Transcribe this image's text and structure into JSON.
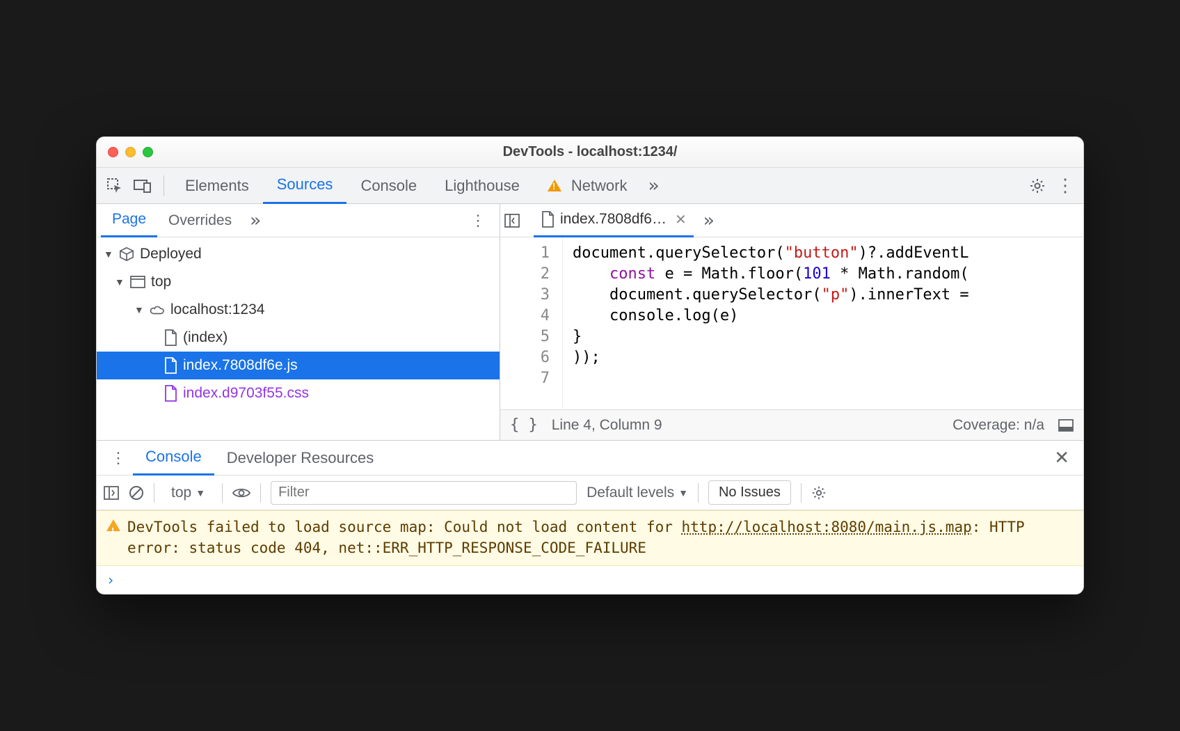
{
  "window": {
    "title": "DevTools - localhost:1234/"
  },
  "panels": {
    "elements": "Elements",
    "sources": "Sources",
    "console": "Console",
    "lighthouse": "Lighthouse",
    "network": "Network"
  },
  "sources": {
    "subtabs": {
      "page": "Page",
      "overrides": "Overrides"
    },
    "tree": {
      "deployed": "Deployed",
      "top": "top",
      "host": "localhost:1234",
      "index": "(index)",
      "js": "index.7808df6e.js",
      "css": "index.d9703f55.css"
    },
    "open_tab": "index.7808df6…",
    "code": {
      "l1": "document.querySelector(\"button\")?.addEventL",
      "l2_pre": "    ",
      "l2_kw": "const",
      "l2_mid": " e = Math.floor(",
      "l2_num": "101",
      "l2_rest": " * Math.random(",
      "l3": "    document.querySelector(\"p\").innerText =",
      "l4": "    console.log(e)",
      "l5": "}",
      "l6": "));",
      "l7": ""
    },
    "status": {
      "pos": "Line 4, Column 9",
      "coverage": "Coverage: n/a"
    }
  },
  "drawer": {
    "console": "Console",
    "devres": "Developer Resources",
    "context": "top",
    "filter_placeholder": "Filter",
    "levels": "Default levels",
    "issues": "No Issues",
    "warn_pre": "DevTools failed to load source map: Could not load content for ",
    "warn_link": "http://localhost:8080/main.js.map",
    "warn_post": ": HTTP error: status code 404, net::ERR_HTTP_RESPONSE_CODE_FAILURE"
  }
}
